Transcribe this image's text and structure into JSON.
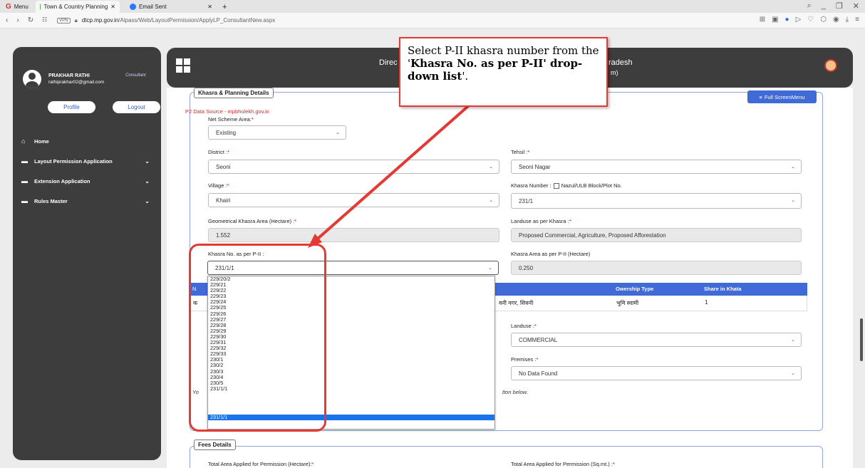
{
  "browser": {
    "menu_label": "Menu",
    "tabs": [
      {
        "label": "Town & Country Planning",
        "close": "✕"
      },
      {
        "label": "Email Sent",
        "close": "✕"
      }
    ],
    "new_tab": "+",
    "url_host": "dtcp.mp.gov.in",
    "url_path": "/Alpass/Web/LayoutPermission/ApplyLP_ConsultantNew.aspx",
    "vpn": "VPN"
  },
  "sidebar": {
    "user_name": "PRAKHAR RATHI",
    "user_email": "rathiprakhar02@gmail.com",
    "role": "Consultant",
    "profile_btn": "Profile",
    "logout_btn": "Logout",
    "items": [
      {
        "label": "Home",
        "icon": "home-icon"
      },
      {
        "label": "Layout Permission Application",
        "icon": "folder-icon"
      },
      {
        "label": "Extension Application",
        "icon": "folder-icon"
      },
      {
        "label": "Rules Master",
        "icon": "folder-icon"
      }
    ]
  },
  "header": {
    "title_left": "Direc",
    "title_right": "radesh",
    "subtitle": "m)"
  },
  "form": {
    "legend": "Khasra & Planning Details",
    "full_screen_btn": "Full ScreenMenu",
    "source": "P2 Data Source - mpbhulekh.gov.in",
    "net_scheme_label": "Net Scheme Area:",
    "net_scheme_value": "Existing",
    "district_label": "District :",
    "district_value": "Seoni",
    "tehsil_label": "Tehsil :",
    "tehsil_value": "Seoni Nagar",
    "village_label": "Village :",
    "village_value": "Khairi",
    "khasra_label": "Khasra Number :",
    "khasra_checkbox_label": "Nazul/ULB Block/Plot No.",
    "khasra_value": "231/1",
    "geo_area_label": "Geometrical Khasra Area (Hectare) :",
    "geo_area_value": "1.552",
    "landuse_khasra_label": "Landuse as per Khasra :",
    "landuse_khasra_value": "Proposed Commercial, Agriculture, Proposed Afforestation",
    "p2_label": "Khasra No. as per P-II :",
    "p2_value": "231/1/1",
    "p2_area_label": "Khasra Area as per P-II (Hectare)",
    "p2_area_value": "0.250",
    "table_headers": [
      "N",
      "Owership Type",
      "Share in Khata"
    ],
    "table_row": [
      "क",
      "वनी नगर, सिवनी",
      "भूमि स्वामी",
      "1"
    ],
    "landuse_label": "Landuse :",
    "landuse_value": "COMMERCIAL",
    "premises_label": "Premises :",
    "premises_value": "No Data Found",
    "note_left": "Yo",
    "note_right": "tton below.",
    "dropdown_options": [
      "229/20/2",
      "229/21",
      "229/22",
      "229/23",
      "229/24",
      "229/25",
      "229/26",
      "229/27",
      "229/28",
      "229/29",
      "229/30",
      "229/31",
      "229/32",
      "229/33",
      "230/1",
      "230/2",
      "230/3",
      "230/4",
      "230/5",
      "231/1/1"
    ],
    "fees_legend": "Fees Details",
    "total_area_label": "Total Area Applied for Permission (Hectare):",
    "total_area_sqmt_label": "Total Area Applied for Permission (Sq.mt.) :"
  },
  "callout": {
    "line1": "Select P-II khasra number from the '",
    "bold1": "Khasra No. as per P-II' drop-down list",
    "line2": "'."
  },
  "colors": {
    "accent": "#3f6ad8",
    "annotation": "#e53935",
    "dark_panel": "#3d3d3d"
  }
}
